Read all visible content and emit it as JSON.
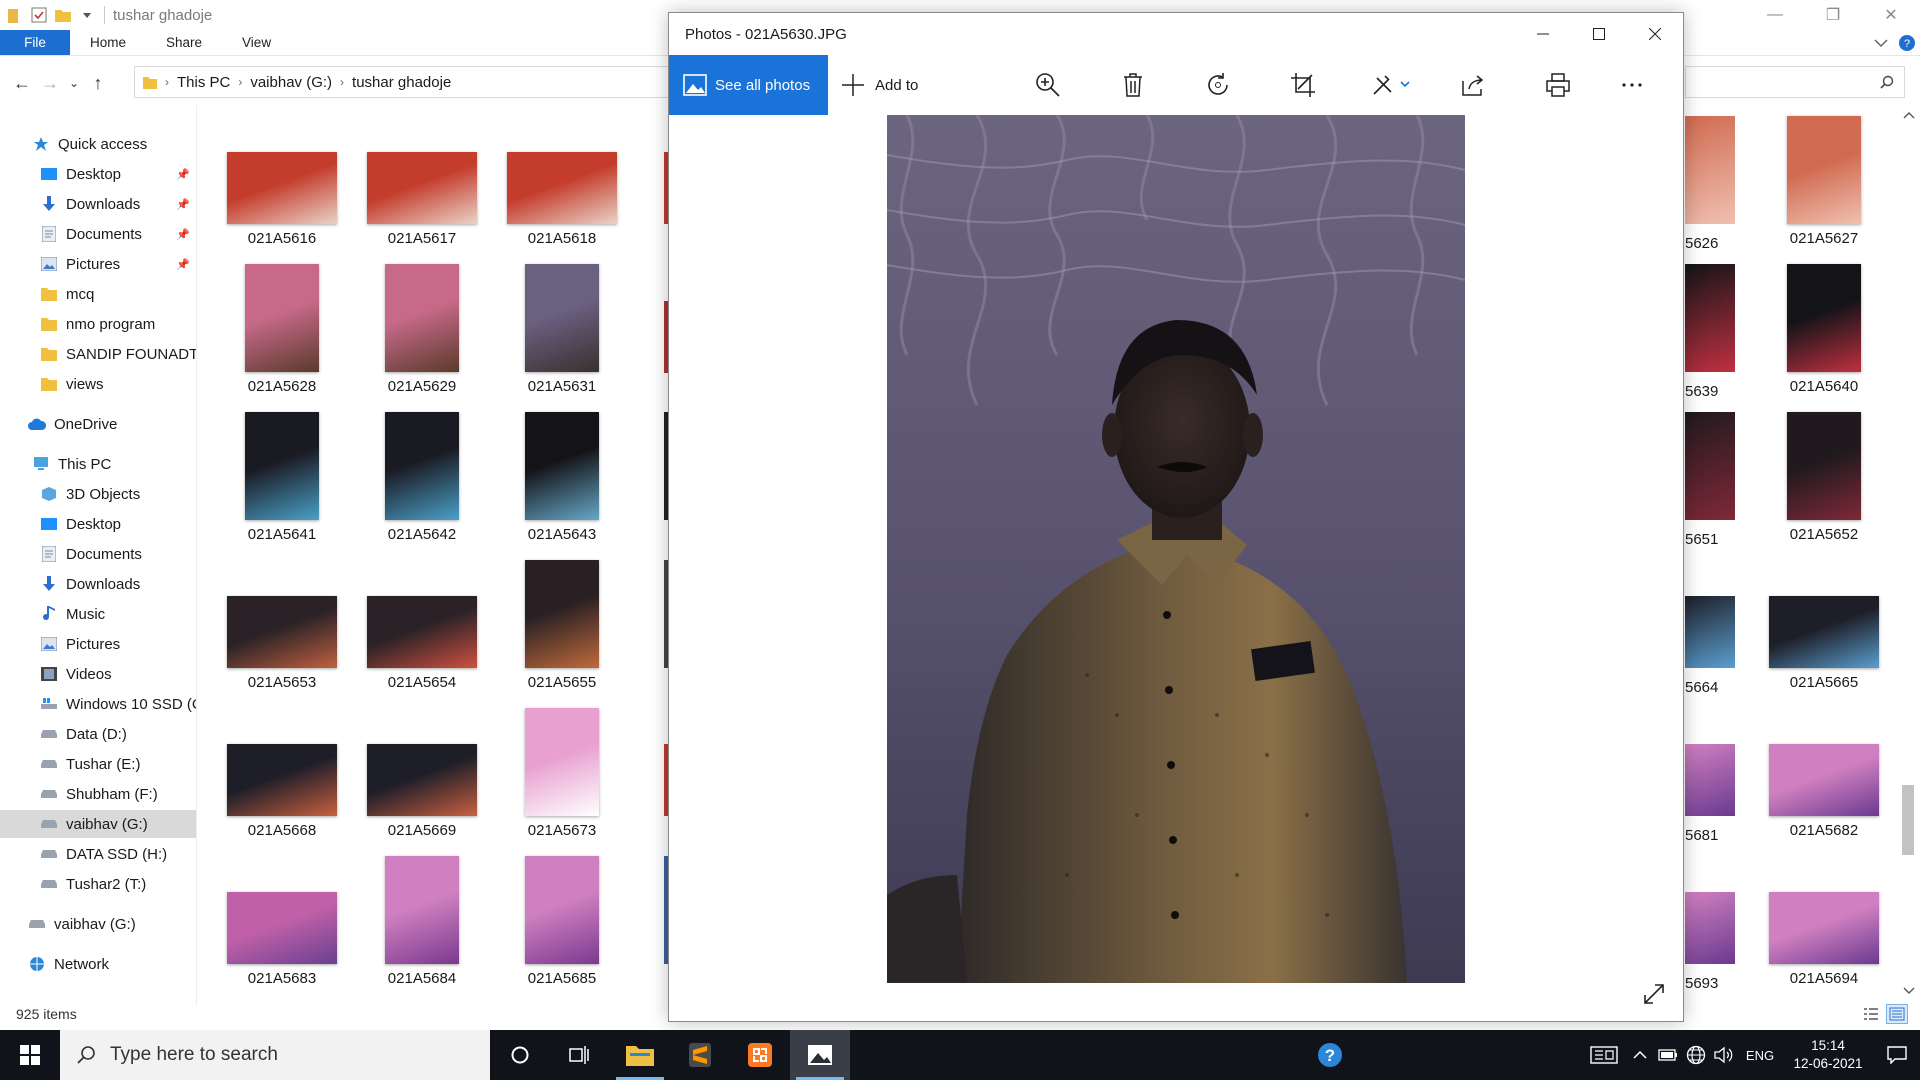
{
  "explorer": {
    "title": "tushar ghadoje",
    "ribbon_tabs": [
      "File",
      "Home",
      "Share",
      "View"
    ],
    "breadcrumb": [
      "This PC",
      "vaibhav  (G:)",
      "tushar ghadoje"
    ],
    "status": "925 items",
    "nav": {
      "quick_access": "Quick access",
      "qa_items": [
        "Desktop",
        "Downloads",
        "Documents",
        "Pictures",
        "mcq",
        "nmo program",
        "SANDIP FOUNADTI",
        "views"
      ],
      "onedrive": "OneDrive",
      "this_pc": "This PC",
      "pc_items": [
        "3D Objects",
        "Desktop",
        "Documents",
        "Downloads",
        "Music",
        "Pictures",
        "Videos",
        "Windows 10 SSD (C",
        "Data (D:)",
        "Tushar (E:)",
        "Shubham (F:)",
        "vaibhav  (G:)",
        "DATA SSD (H:)",
        "Tushar2 (T:)"
      ],
      "drive_root": "vaibhav  (G:)",
      "network": "Network"
    },
    "thumbs_left": [
      [
        "021A5616",
        "021A5617",
        "021A5618"
      ],
      [
        "021A5628",
        "021A5629",
        "021A5631"
      ],
      [
        "021A5641",
        "021A5642",
        "021A5643"
      ],
      [
        "021A5653",
        "021A5654",
        "021A5655"
      ],
      [
        "021A5668",
        "021A5669",
        "021A5673"
      ],
      [
        "021A5683",
        "021A5684",
        "021A5685"
      ]
    ],
    "thumbs_right_partial": [
      "5626",
      "5639",
      "5651",
      "5664",
      "5681",
      "5693"
    ],
    "thumbs_right": [
      "021A5627",
      "021A5640",
      "021A5652",
      "021A5665",
      "021A5682",
      "021A5694"
    ]
  },
  "photos": {
    "title": "Photos - 021A5630.JPG",
    "see_all": "See all photos",
    "add_to": "Add to",
    "tools": [
      "zoom-icon",
      "delete-icon",
      "rotate-icon",
      "crop-icon",
      "edit-icon",
      "share-icon",
      "print-icon",
      "more-icon"
    ]
  },
  "taskbar": {
    "search_placeholder": "Type here to search",
    "lang": "ENG",
    "time": "15:14",
    "date": "12-06-2021"
  },
  "colors": {
    "accent": "#1a73d9",
    "file_tab": "#1c6fd1",
    "taskbar": "#10141a"
  }
}
